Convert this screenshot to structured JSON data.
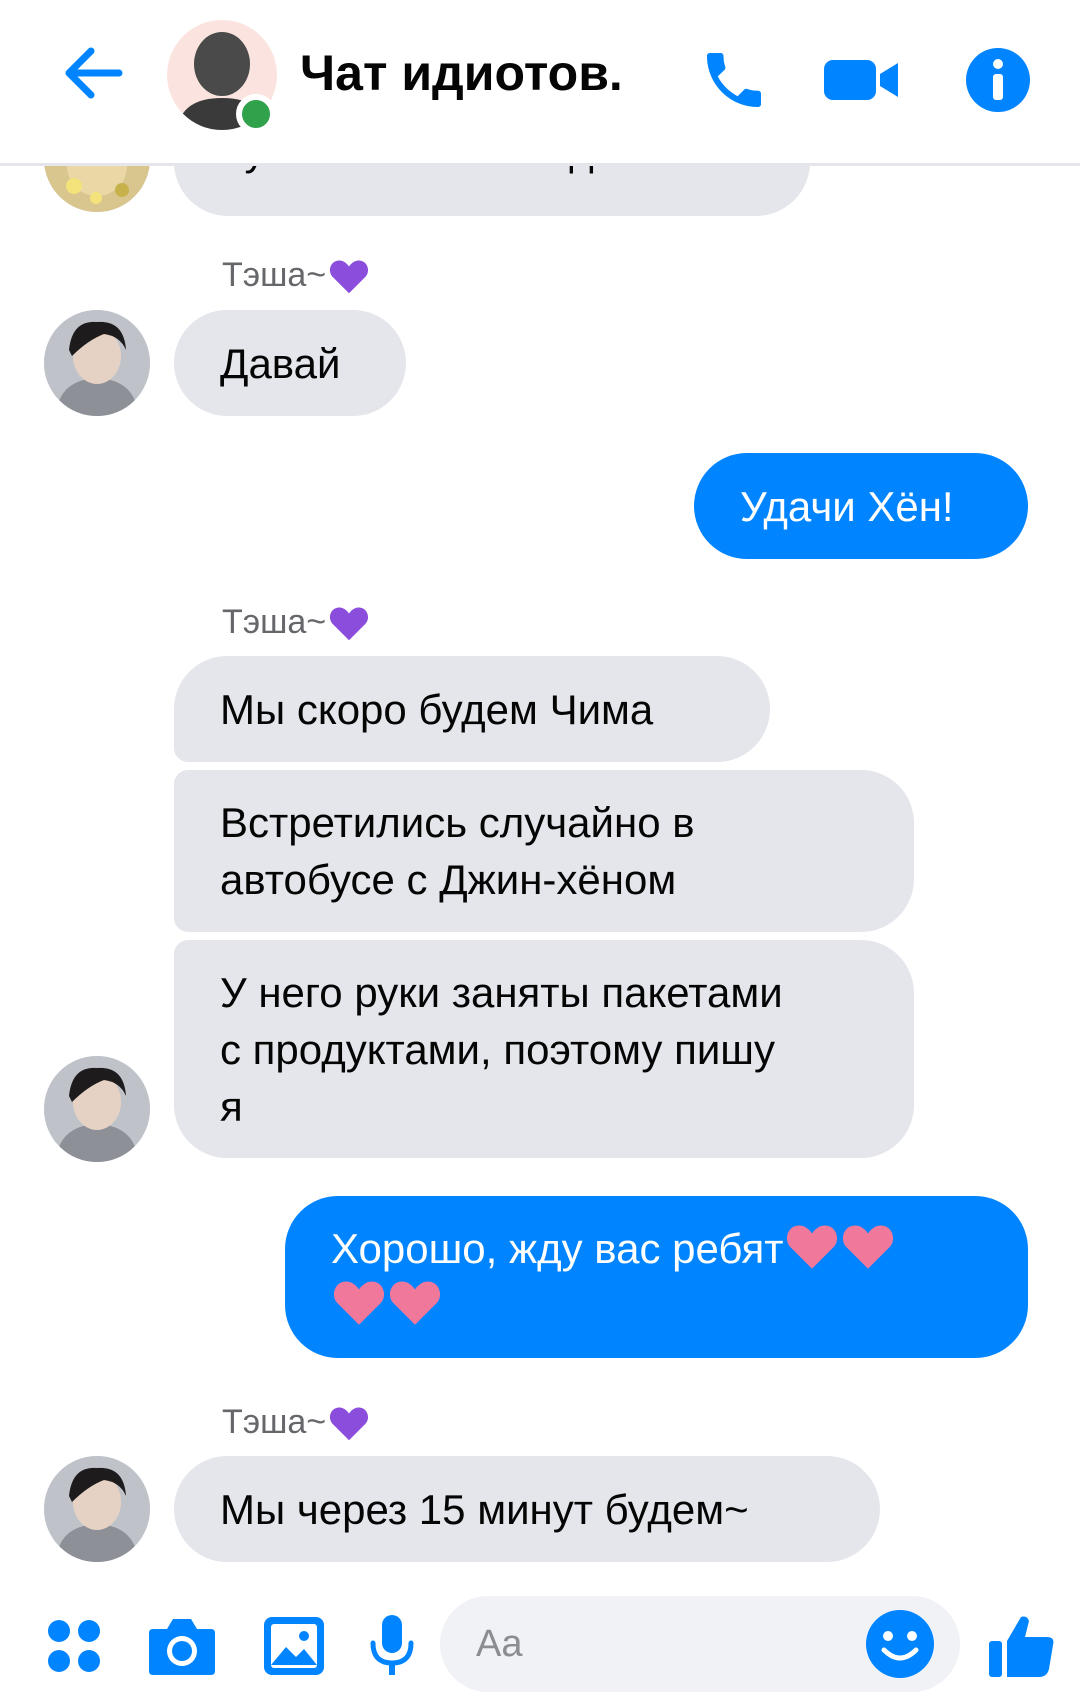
{
  "header": {
    "title": "Чат идиотов.",
    "back_icon": "arrow-left-icon",
    "call_icon": "phone-icon",
    "video_icon": "video-camera-icon",
    "info_icon": "info-icon",
    "accent": "#0084ff",
    "online_color": "#31a24c"
  },
  "messages": {
    "partial_top": "Куплю все необходимое",
    "sender_1": "Тэша~",
    "msg_1": "Давай",
    "out_1": "Удачи Хён!",
    "sender_2": "Тэша~",
    "msg_2": "Мы скоро будем Чима",
    "msg_3": "Встретились случайно в автобусе с Джин-хёном",
    "msg_4": "У него руки заняты пакетами с продуктами, поэтому пишу я",
    "out_2": "Хорошо, жду вас ребят",
    "sender_3": "Тэша~",
    "msg_5": "Мы через 15 минут будем~"
  },
  "colors": {
    "incoming_bubble": "#e4e6eb",
    "outgoing_bubble": "#0084ff",
    "sender_heart": "#8b4ddb",
    "reaction_heart": "#f0789a"
  },
  "composer": {
    "placeholder": "Aa",
    "icons": [
      "apps-icon",
      "camera-icon",
      "image-icon",
      "microphone-icon",
      "emoji-icon",
      "thumbs-up-icon"
    ]
  }
}
